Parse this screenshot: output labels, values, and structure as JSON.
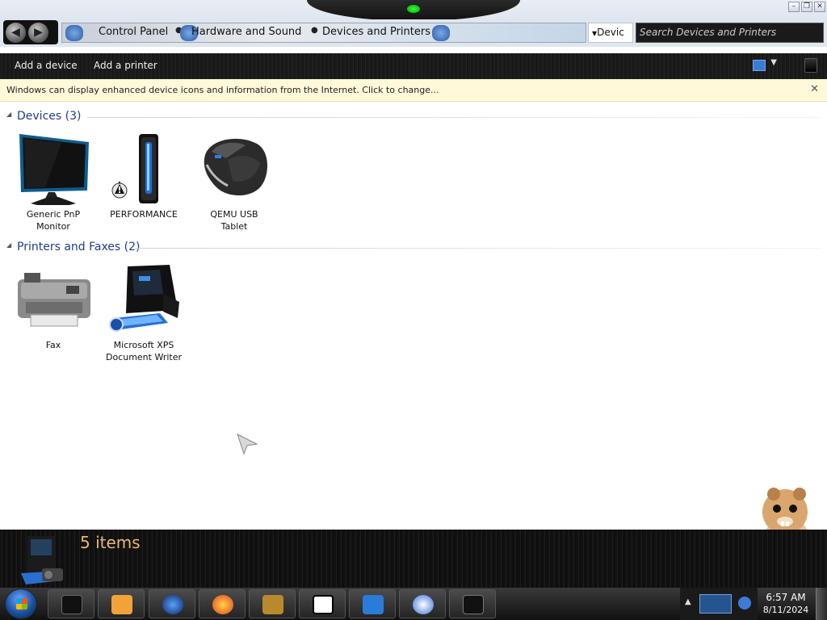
{
  "window": {
    "minimize": "–",
    "maximize": "❐",
    "close": "✕"
  },
  "address": {
    "crumbs": [
      "Control Panel",
      "Hardware and Sound",
      "Devices and Printers"
    ],
    "recent": "Devic",
    "search_placeholder": "Search Devices and Printers"
  },
  "toolbar": {
    "add_device": "Add a device",
    "add_printer": "Add a printer"
  },
  "infobar": {
    "message": "Windows can display enhanced device icons and information from the Internet. Click to change...",
    "close": "✕"
  },
  "groups": {
    "devices": {
      "label": "Devices (3)",
      "items": [
        {
          "name_line1": "Generic PnP",
          "name_line2": "Monitor",
          "icon": "monitor-icon"
        },
        {
          "name_line1": "PERFORMANCE",
          "name_line2": "",
          "icon": "computer-tower-icon"
        },
        {
          "name_line1": "QEMU USB",
          "name_line2": "Tablet",
          "icon": "mouse-icon"
        }
      ]
    },
    "printers": {
      "label": "Printers and Faxes (2)",
      "items": [
        {
          "name_line1": "Fax",
          "name_line2": "",
          "icon": "fax-icon"
        },
        {
          "name_line1": "Microsoft XPS",
          "name_line2": "Document Writer",
          "icon": "xps-printer-icon"
        }
      ]
    }
  },
  "details": {
    "count": "5 items"
  },
  "taskbar": {
    "time": "6:57 AM",
    "date": "8/11/2024"
  },
  "colors": {
    "accent_link": "#1e3c8c",
    "details_count": "#e9b86a",
    "infobar_bg": "#fdf9d9"
  }
}
